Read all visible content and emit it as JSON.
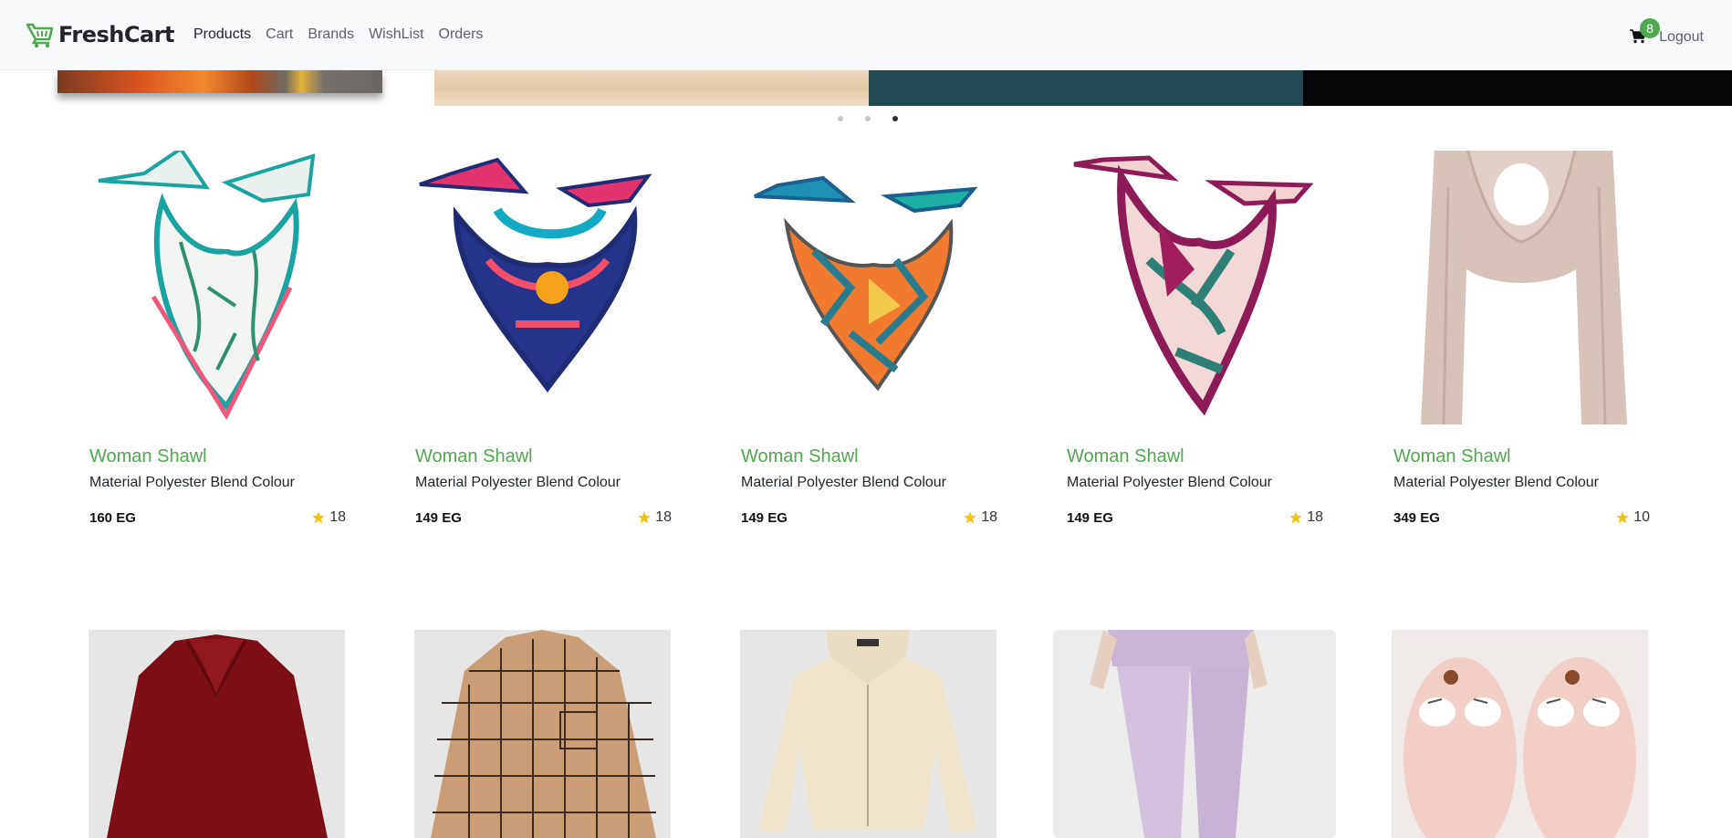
{
  "navbar": {
    "brand": "FreshCart",
    "links": [
      "Products",
      "Cart",
      "Brands",
      "WishList",
      "Orders"
    ],
    "cart_count": "8",
    "logout": "Logout",
    "accent": "#4fa74f"
  },
  "slider": {
    "dots": 3,
    "active_dot": 3
  },
  "products": [
    {
      "title": "Woman Shawl",
      "desc": "Material Polyester Blend Colour",
      "price": "160 EG",
      "rating": "18",
      "image": "floral-white-scarf"
    },
    {
      "title": "Woman Shawl",
      "desc": "Material Polyester Blend Colour",
      "price": "149 EG",
      "rating": "18",
      "image": "navy-pink-scarf"
    },
    {
      "title": "Woman Shawl",
      "desc": "Material Polyester Blend Colour",
      "price": "149 EG",
      "rating": "18",
      "image": "orange-teal-scarf"
    },
    {
      "title": "Woman Shawl",
      "desc": "Material Polyester Blend Colour",
      "price": "149 EG",
      "rating": "18",
      "image": "burgundy-leaf-scarf"
    },
    {
      "title": "Woman Shawl",
      "desc": "Material Polyester Blend Colour",
      "price": "349 EG",
      "rating": "10",
      "image": "beige-long-shawl"
    }
  ],
  "products_row2": [
    {
      "image": "burgundy-blouse"
    },
    {
      "image": "plaid-shirt"
    },
    {
      "image": "cream-hoodie"
    },
    {
      "image": "lavender-tracksuit"
    },
    {
      "image": "pink-fluffy-slippers"
    }
  ]
}
